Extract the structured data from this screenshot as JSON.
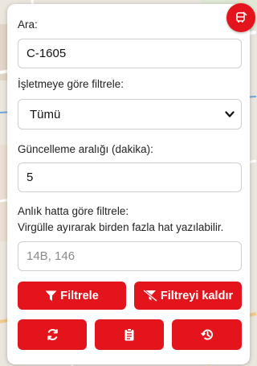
{
  "search": {
    "label": "Ara:",
    "value": "C-1605"
  },
  "operator_filter": {
    "label": "İşletmeye göre filtrele:",
    "selected": "Tümü"
  },
  "refresh_interval": {
    "label": "Güncelleme aralığı (dakika):",
    "value": "5"
  },
  "line_filter": {
    "label_line1": "Anlık hatta göre filtrele:",
    "label_line2": "Virgülle ayırarak birden fazla hat yazılabilir.",
    "placeholder": "14B, 146"
  },
  "buttons": {
    "filter_label": "Filtrele",
    "clear_filter_label": "Filtreyi kaldır"
  },
  "icons": {
    "close": "bus-off-icon",
    "filter": "filter-icon",
    "clear_filter": "filter-slash-icon",
    "refresh": "refresh-icon",
    "clipboard": "clipboard-list-icon",
    "history": "history-icon"
  },
  "colors": {
    "accent": "#e3141c",
    "panel": "#ffffff"
  }
}
